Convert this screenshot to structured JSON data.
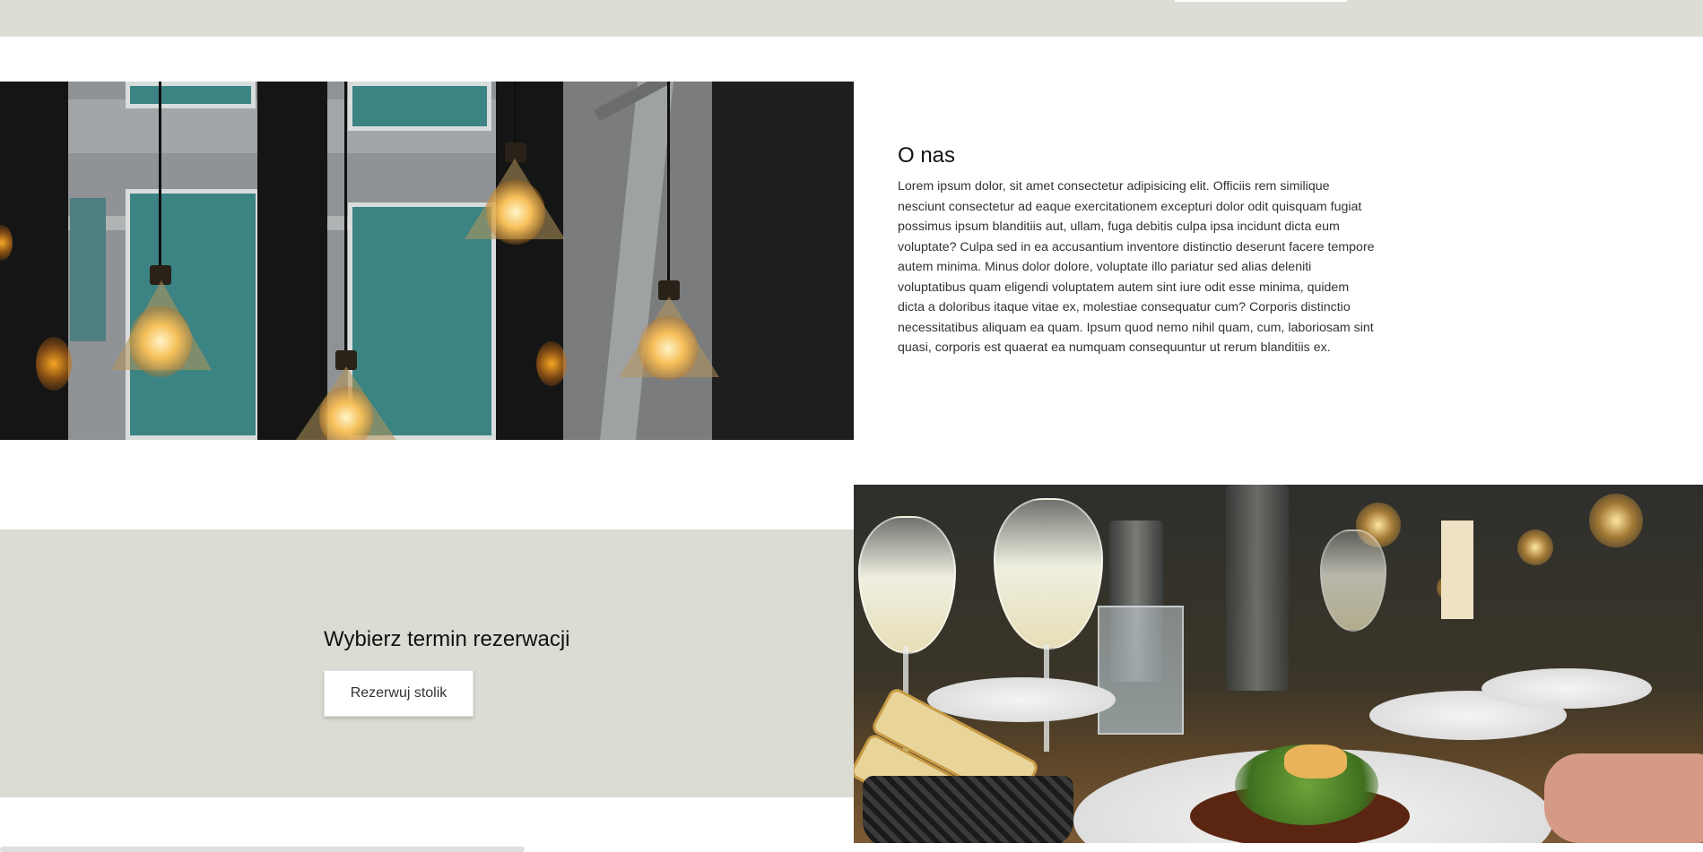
{
  "about": {
    "title": "O nas",
    "text": "Lorem ipsum dolor, sit amet consectetur adipisicing elit. Officiis rem similique nesciunt consectetur ad eaque exercitationem excepturi dolor odit quisquam fugiat possimus ipsum blanditiis aut, ullam, fuga debitis culpa ipsa incidunt dicta eum voluptate? Culpa sed in ea accusantium inventore distinctio deserunt facere tempore autem minima. Minus dolor dolore, voluptate illo pariatur sed alias deleniti voluptatibus quam eligendi voluptatem autem sint iure odit esse minima, quidem dicta a doloribus itaque vitae ex, molestiae consequatur cum? Corporis distinctio necessitatibus aliquam ea quam. Ipsum quod nemo nihil quam, cum, laboriosam sint quasi, corporis est quaerat ea numquam consequuntur ut rerum blanditiis ex."
  },
  "reservation": {
    "title": "Wybierz termin rezerwacji",
    "button_label": "Rezerwuj stolik"
  },
  "colors": {
    "band_background": "#dbdcd3",
    "page_background": "#ffffff",
    "text_primary": "#111111"
  }
}
